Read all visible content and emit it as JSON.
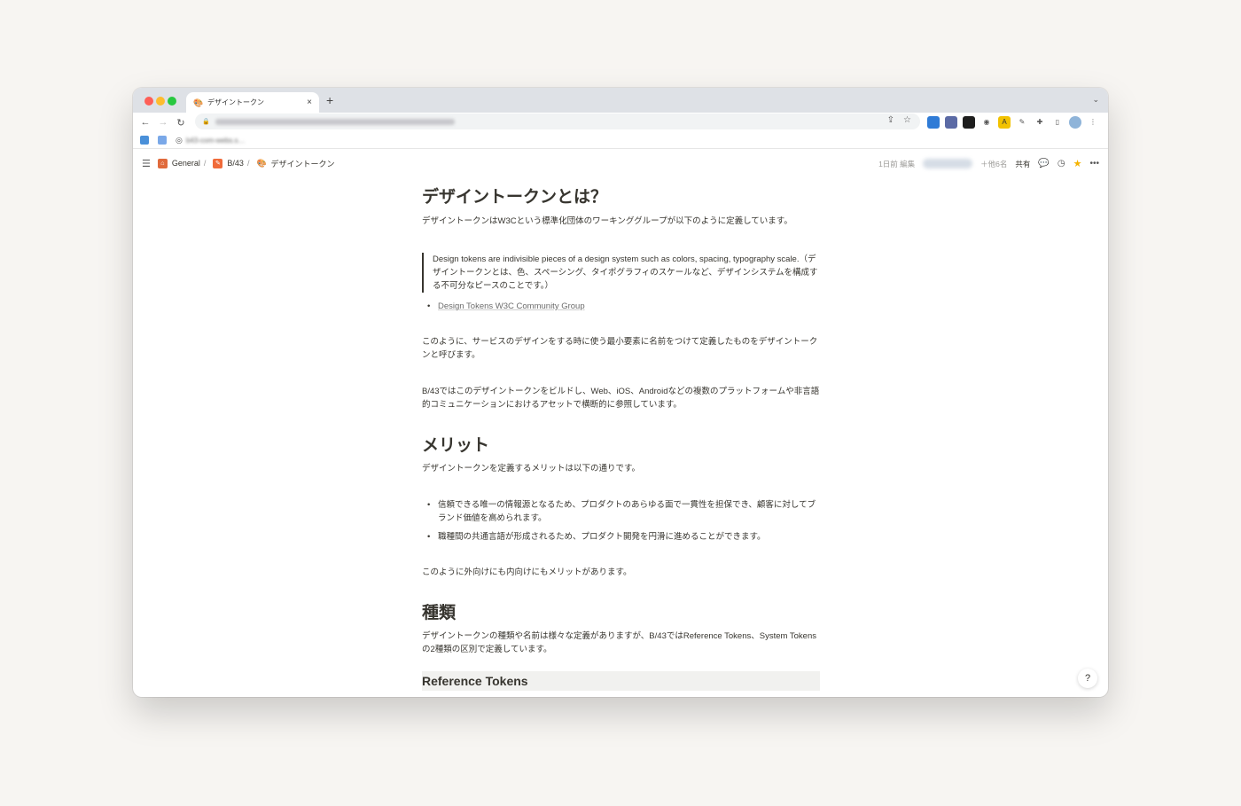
{
  "browser": {
    "tab_title": "デザイントークン",
    "tab_close": "×",
    "new_tab": "+",
    "bookmark_label": "b43-com-webs.s…",
    "colors": {
      "tabstrip": "#dee1e6",
      "omnibox": "#f1f3f4"
    }
  },
  "app": {
    "breadcrumbs": [
      {
        "label": "General",
        "sep": "/"
      },
      {
        "label": "B/43",
        "sep": "/"
      },
      {
        "label": "デザイントークン",
        "sep": ""
      }
    ],
    "edited": "1日前 編集",
    "others": "＋他6名",
    "share": "共有",
    "help": "?"
  },
  "doc": {
    "heading1": "デザイントークンとは？",
    "intro": "デザイントークンはW3Cという標準化団体のワーキンググループが以下のように定義しています。",
    "quote": "Design tokens are indivisible pieces of a design system such as colors, spacing, typography scale.（デザイントークンとは、色、スペーシング、タイポグラフィのスケールなど、デザインシステムを構成する不可分なピースのことです。）",
    "link": "Design Tokens W3C Community Group",
    "para1": "このように、サービスのデザインをする時に使う最小要素に名前をつけて定義したものをデザイントークンと呼びます。",
    "para2": "B/43ではこのデザイントークンをビルドし、Web、iOS、Androidなどの複数のプラットフォームや非言語的コミュニケーションにおけるアセットで横断的に参照しています。",
    "heading2": "メリット",
    "merit_intro": "デザイントークンを定義するメリットは以下の通りです。",
    "merits": [
      "信頼できる唯一の情報源となるため、プロダクトのあらゆる面で一貫性を担保でき、顧客に対してブランド価値を高められます。",
      "職種間の共通言語が形成されるため、プロダクト開発を円滑に進めることができます。"
    ],
    "merit_outro": "このように外向けにも内向けにもメリットがあります。",
    "heading3": "種類",
    "types_intro": "デザイントークンの種類や名前は様々な定義がありますが、B/43ではReference Tokens、System Tokensの2種類の区別で定義しています。",
    "subheading": "Reference Tokens"
  }
}
